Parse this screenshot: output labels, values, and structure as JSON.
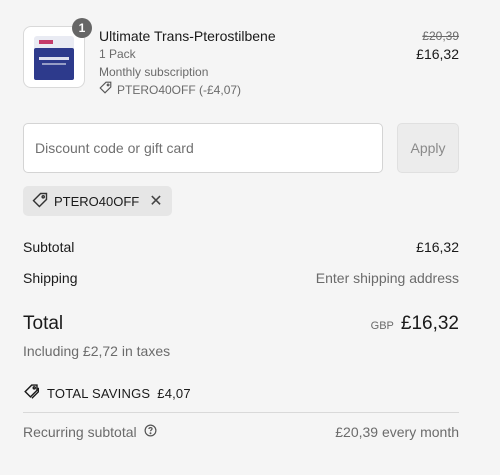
{
  "product": {
    "quantity": "1",
    "name": "Ultimate Trans-Pterostilbene",
    "pack": "1 Pack",
    "subscription": "Monthly subscription",
    "discount_line": "PTERO40OFF (-£4,07)",
    "original_price": "£20,39",
    "price": "£16,32",
    "image_text": "Pterostilbene"
  },
  "discount": {
    "placeholder": "Discount code or gift card",
    "apply_label": "Apply",
    "applied_code": "PTERO40OFF"
  },
  "summary": {
    "subtotal_label": "Subtotal",
    "subtotal_value": "£16,32",
    "shipping_label": "Shipping",
    "shipping_value": "Enter shipping address",
    "total_label": "Total",
    "currency": "GBP",
    "total_value": "£16,32",
    "taxes_note": "Including £2,72 in taxes",
    "savings_label": "TOTAL SAVINGS",
    "savings_value": "£4,07",
    "recurring_label": "Recurring subtotal",
    "recurring_value": "£20,39 every month"
  },
  "icons": {
    "tag": "tag-icon",
    "close": "close-icon",
    "savings": "tags-icon",
    "info": "info-icon"
  }
}
